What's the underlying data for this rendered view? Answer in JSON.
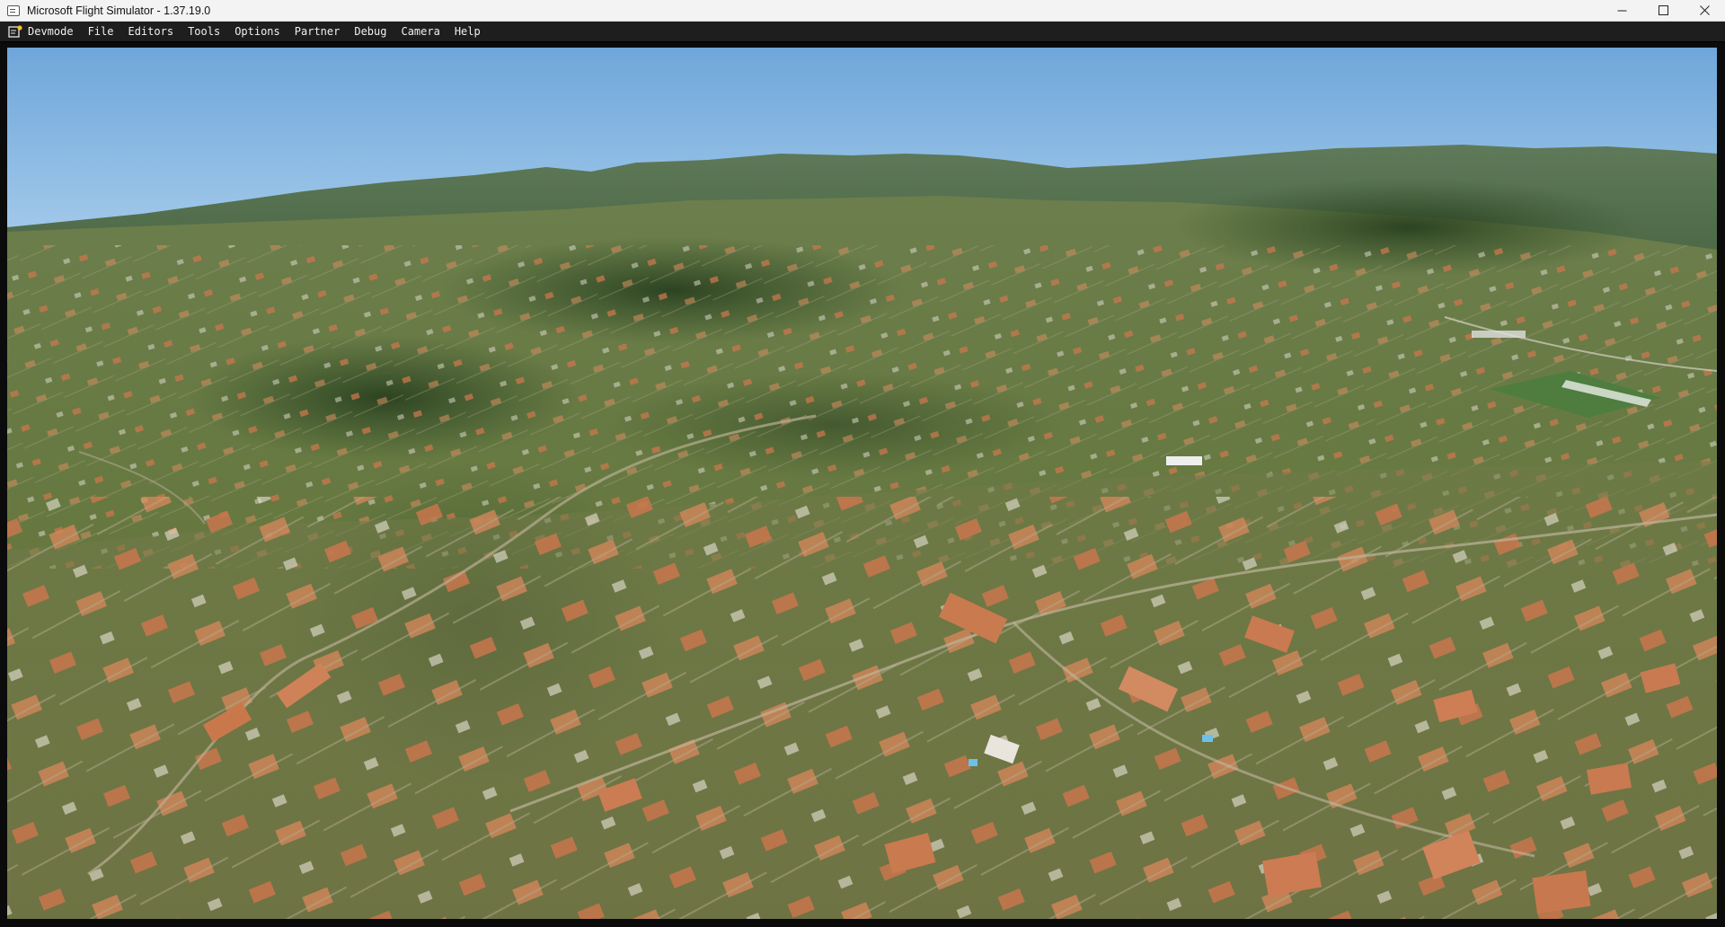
{
  "window": {
    "title": "Microsoft Flight Simulator - 1.37.19.0",
    "icon": "app-window-icon",
    "controls": [
      "minimize-icon",
      "maximize-icon",
      "close-icon"
    ]
  },
  "menubar": {
    "icon": "devmode-notepad-icon",
    "items": [
      "Devmode",
      "File",
      "Editors",
      "Tools",
      "Options",
      "Partner",
      "Debug",
      "Camera",
      "Help"
    ]
  },
  "viewport": {
    "content": "3d-scene",
    "colors": {
      "sky_top": "#6fa6da",
      "sky_horizon": "#c3dcef",
      "vegetation": "#4f6f35",
      "roof": "#c9764c"
    }
  }
}
